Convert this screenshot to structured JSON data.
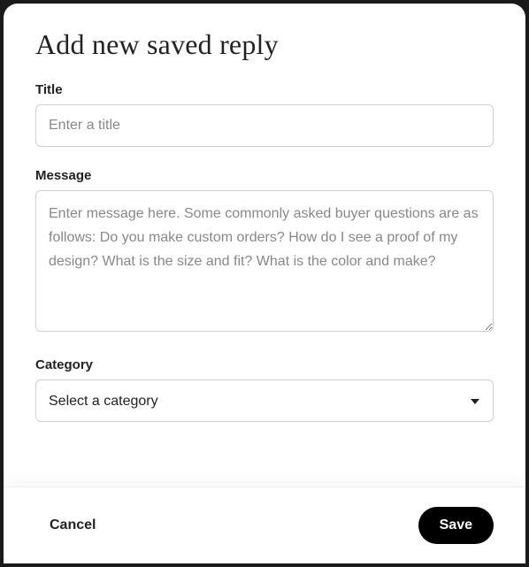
{
  "modal": {
    "title": "Add new saved reply",
    "fields": {
      "title": {
        "label": "Title",
        "placeholder": "Enter a title",
        "value": ""
      },
      "message": {
        "label": "Message",
        "placeholder": "Enter message here. Some commonly asked buyer questions are as follows: Do you make custom orders? How do I see a proof of my design? What is the size and fit? What is the color and make?",
        "value": ""
      },
      "category": {
        "label": "Category",
        "placeholder": "Select a category",
        "value": ""
      }
    },
    "actions": {
      "cancel": "Cancel",
      "save": "Save"
    }
  }
}
